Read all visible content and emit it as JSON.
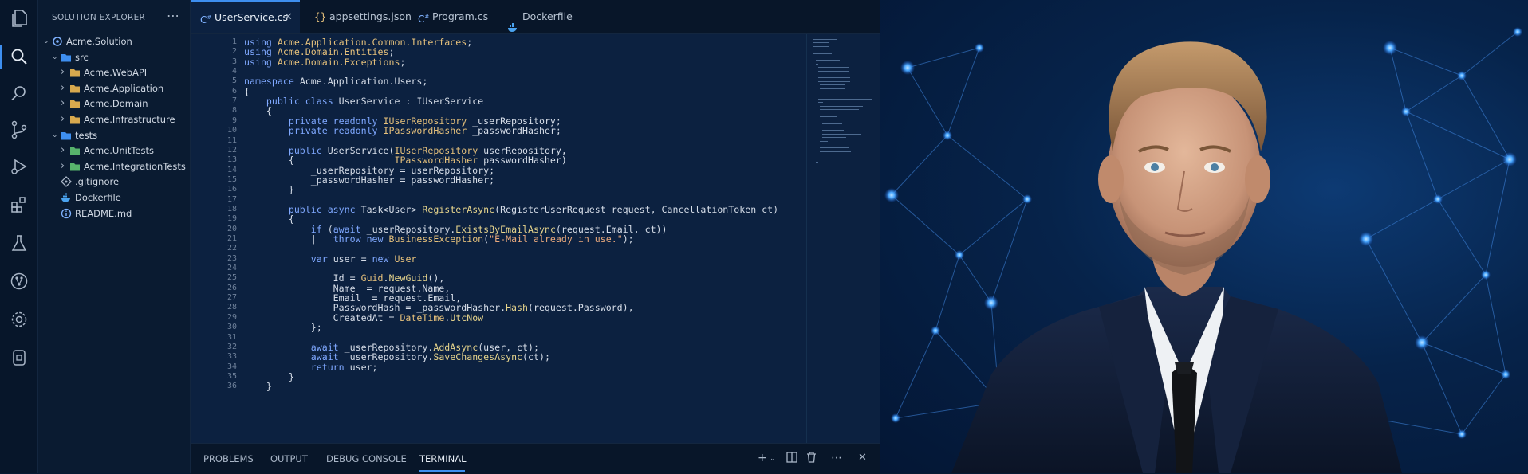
{
  "explorer": {
    "title": "SOLUTION EXPLORER",
    "tree": [
      {
        "label": "Acme.Solution",
        "indent": 0,
        "chev": "v",
        "icon": "solution"
      },
      {
        "label": "src",
        "indent": 1,
        "chev": "v",
        "icon": "folder-blue"
      },
      {
        "label": "Acme.WebAPI",
        "indent": 2,
        "chev": ">",
        "icon": "folder"
      },
      {
        "label": "Acme.Application",
        "indent": 2,
        "chev": ">",
        "icon": "folder"
      },
      {
        "label": "Acme.Domain",
        "indent": 2,
        "chev": ">",
        "icon": "folder"
      },
      {
        "label": "Acme.Infrastructure",
        "indent": 2,
        "chev": ">",
        "icon": "folder"
      },
      {
        "label": "tests",
        "indent": 1,
        "chev": "v",
        "icon": "folder-blue"
      },
      {
        "label": "Acme.UnitTests",
        "indent": 2,
        "chev": ">",
        "icon": "folder-green"
      },
      {
        "label": "Acme.IntegrationTests",
        "indent": 2,
        "chev": ">",
        "icon": "folder-green"
      },
      {
        "label": ".gitignore",
        "indent": 1,
        "chev": "",
        "icon": "git"
      },
      {
        "label": "Dockerfile",
        "indent": 1,
        "chev": "",
        "icon": "docker"
      },
      {
        "label": "README.md",
        "indent": 1,
        "chev": "",
        "icon": "info"
      }
    ]
  },
  "tabs": [
    {
      "label": "UserService.cs",
      "icon": "C#",
      "active": true,
      "closable": true
    },
    {
      "label": "appsettings.json",
      "icon": "{}",
      "active": false
    },
    {
      "label": "Program.cs",
      "icon": "C#",
      "active": false
    },
    {
      "label": "Dockerfile",
      "icon": "docker",
      "active": false
    }
  ],
  "code": [
    [
      [
        "kw",
        "using "
      ],
      [
        "ty",
        "Acme.Application.Common.Interfaces"
      ],
      [
        "pl",
        ";"
      ]
    ],
    [
      [
        "kw",
        "using "
      ],
      [
        "ty",
        "Acme.Domain.Entities"
      ],
      [
        "pl",
        ";"
      ]
    ],
    [
      [
        "kw",
        "using "
      ],
      [
        "ty",
        "Acme.Domain.Exceptions"
      ],
      [
        "pl",
        ";"
      ]
    ],
    [],
    [
      [
        "kw",
        "namespace "
      ],
      [
        "pl",
        "Acme.Application.Users;"
      ]
    ],
    [
      [
        "pl",
        "{"
      ]
    ],
    [
      [
        "pl",
        "    "
      ],
      [
        "kw",
        "public class "
      ],
      [
        "pl",
        "UserService : IUserService"
      ]
    ],
    [
      [
        "pl",
        "    {"
      ]
    ],
    [
      [
        "pl",
        "        "
      ],
      [
        "kw",
        "private readonly "
      ],
      [
        "ty",
        "IUserRepository"
      ],
      [
        "pl",
        " _userRepository;"
      ]
    ],
    [
      [
        "pl",
        "        "
      ],
      [
        "kw",
        "private readonly "
      ],
      [
        "ty",
        "IPasswordHasher"
      ],
      [
        "pl",
        " _passwordHasher;"
      ]
    ],
    [],
    [
      [
        "pl",
        "        "
      ],
      [
        "kw",
        "public "
      ],
      [
        "pl",
        "UserService("
      ],
      [
        "ty",
        "IUserRepository"
      ],
      [
        "pl",
        " userRepository,"
      ]
    ],
    [
      [
        "pl",
        "        {                  "
      ],
      [
        "ty",
        "IPasswordHasher"
      ],
      [
        "pl",
        " passwordHasher)"
      ]
    ],
    [
      [
        "pl",
        "            _userRepository = userRepository;"
      ]
    ],
    [
      [
        "pl",
        "            _passwordHasher = passwordHasher;"
      ]
    ],
    [
      [
        "pl",
        "        }"
      ]
    ],
    [],
    [
      [
        "pl",
        "        "
      ],
      [
        "kw",
        "public async "
      ],
      [
        "pl",
        "Task<User> "
      ],
      [
        "fn",
        "RegisterAsync"
      ],
      [
        "pl",
        "(RegisterUserRequest request, CancellationToken ct)"
      ]
    ],
    [
      [
        "pl",
        "        {"
      ]
    ],
    [
      [
        "pl",
        "            "
      ],
      [
        "kw",
        "if "
      ],
      [
        "pl",
        "("
      ],
      [
        "kw",
        "await "
      ],
      [
        "pl",
        "_userRepository."
      ],
      [
        "fn",
        "ExistsByEmailAsync"
      ],
      [
        "pl",
        "(request.Email, ct))"
      ]
    ],
    [
      [
        "pl",
        "            |   "
      ],
      [
        "kw",
        "throw new "
      ],
      [
        "ty",
        "BusinessException"
      ],
      [
        "pl",
        "("
      ],
      [
        "str",
        "\"E-Mail already in use.\""
      ],
      [
        "pl",
        ");"
      ]
    ],
    [],
    [
      [
        "pl",
        "            "
      ],
      [
        "kw",
        "var "
      ],
      [
        "pl",
        "user = "
      ],
      [
        "kw",
        "new "
      ],
      [
        "ty",
        "User"
      ]
    ],
    [],
    [
      [
        "pl",
        "                Id = "
      ],
      [
        "ty",
        "Guid"
      ],
      [
        "pl",
        "."
      ],
      [
        "fn",
        "NewGuid"
      ],
      [
        "pl",
        "(),"
      ]
    ],
    [
      [
        "pl",
        "                Name  = request.Name,"
      ]
    ],
    [
      [
        "pl",
        "                Email  = request.Email,"
      ]
    ],
    [
      [
        "pl",
        "                PasswordHash = _passwordHasher."
      ],
      [
        "fn",
        "Hash"
      ],
      [
        "pl",
        "(request.Password),"
      ]
    ],
    [
      [
        "pl",
        "                CreatedAt = "
      ],
      [
        "ty",
        "DateTime"
      ],
      [
        "pl",
        "."
      ],
      [
        "fn",
        "UtcNow"
      ]
    ],
    [
      [
        "pl",
        "            };"
      ]
    ],
    [],
    [
      [
        "pl",
        "            "
      ],
      [
        "kw",
        "await "
      ],
      [
        "pl",
        "_userRepository."
      ],
      [
        "fn",
        "AddAsync"
      ],
      [
        "pl",
        "(user, ct);"
      ]
    ],
    [
      [
        "pl",
        "            "
      ],
      [
        "kw",
        "await "
      ],
      [
        "pl",
        "_userRepository."
      ],
      [
        "fn",
        "SaveChangesAsync"
      ],
      [
        "pl",
        "(ct);"
      ]
    ],
    [
      [
        "pl",
        "            "
      ],
      [
        "kw",
        "return "
      ],
      [
        "pl",
        "user;"
      ]
    ],
    [
      [
        "pl",
        "        }"
      ]
    ],
    [
      [
        "pl",
        "    }"
      ]
    ]
  ],
  "line_numbers": [
    "1",
    "2",
    "3",
    "4",
    "5",
    "6",
    "7",
    "8",
    "9",
    "10",
    "11",
    "12",
    "13",
    "14",
    "15",
    "16",
    "17",
    "18",
    "19",
    "20",
    "21",
    "22",
    "23",
    "24",
    "25",
    "26",
    "27",
    "28",
    "29",
    "30",
    "31",
    "32",
    "33",
    "34",
    "35",
    "36"
  ],
  "panel": {
    "tabs": [
      {
        "label": "PROBLEMS",
        "active": false
      },
      {
        "label": "OUTPUT",
        "active": false
      },
      {
        "label": "DEBUG CONSOLE",
        "active": false
      },
      {
        "label": "TERMINAL",
        "active": true
      }
    ]
  },
  "colors": {
    "accent": "#3e8ff0",
    "editor_bg": "#0c2140",
    "sidebar_bg": "#0a1b31"
  }
}
